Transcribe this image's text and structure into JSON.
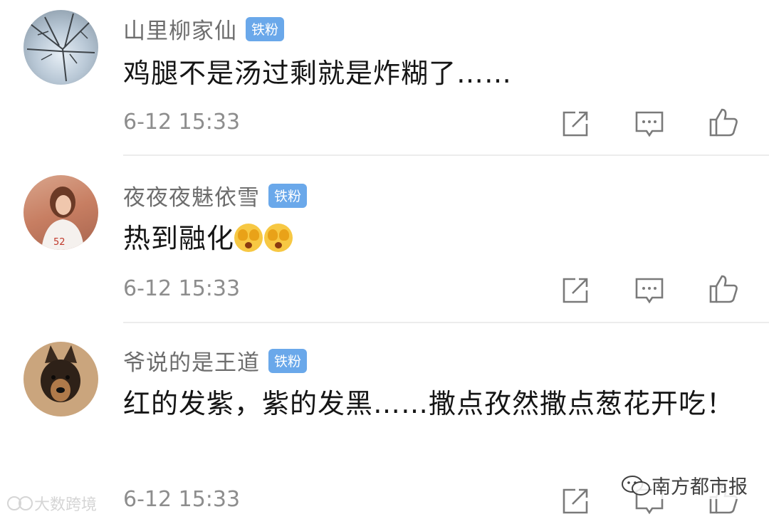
{
  "comments": [
    {
      "user": "山里柳家仙",
      "badge": "铁粉",
      "text": "鸡腿不是汤过剩就是炸糊了……",
      "time": "6-12 15:33"
    },
    {
      "user": "夜夜夜魅依雪",
      "badge": "铁粉",
      "text": "热到融化",
      "emoji": "捂脸-emoji",
      "time": "6-12 15:33"
    },
    {
      "user": "爷说的是王道",
      "badge": "铁粉",
      "text": "红的发紫，紫的发黑……撒点孜然撒点葱花开吃！",
      "time": "6-12 15:33"
    }
  ],
  "icons": {
    "share": "share-icon",
    "reply": "comment-icon",
    "like": "thumbs-up-icon"
  },
  "watermarks": {
    "left": "大数跨境",
    "right": "南方都市报"
  },
  "colors": {
    "badge": "#6aa8ea",
    "name": "#6d6d6d",
    "text": "#151515",
    "meta": "#8d8d8d"
  }
}
